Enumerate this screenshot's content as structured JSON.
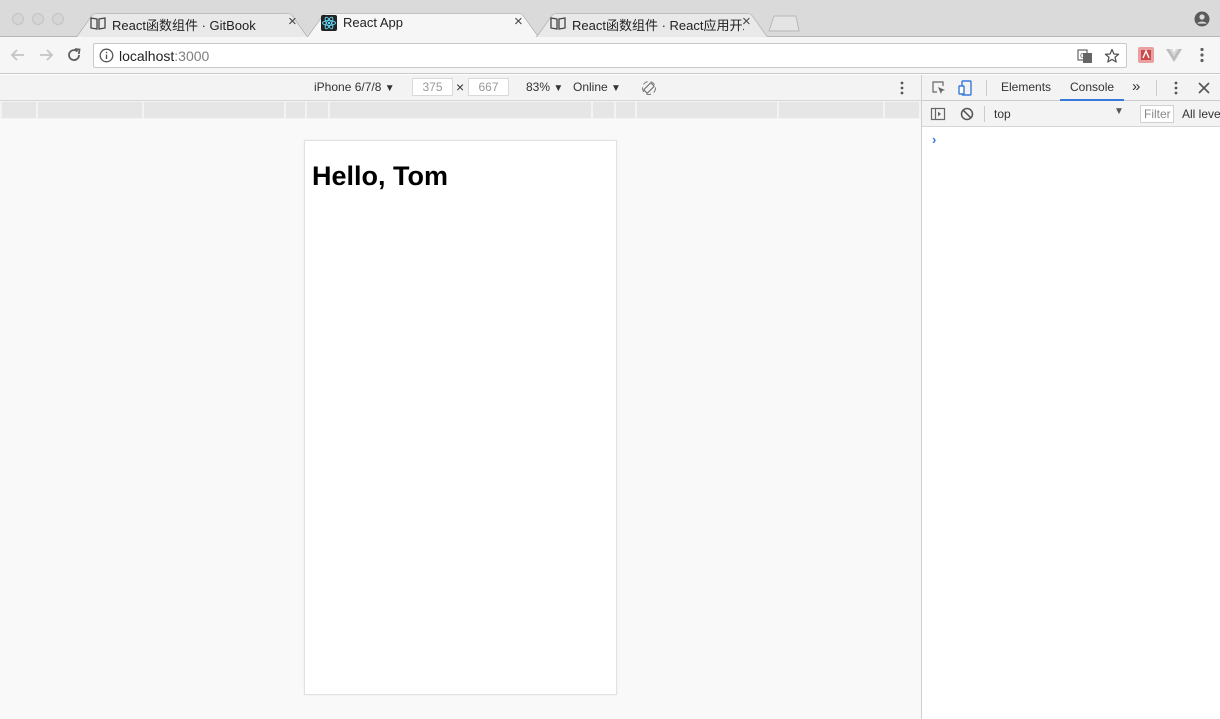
{
  "browser": {
    "tabs": [
      {
        "title": "React函数组件 · GitBook",
        "favicon": "book-icon",
        "active": false
      },
      {
        "title": "React App",
        "favicon": "react-logo-icon",
        "active": true
      },
      {
        "title": "React函数组件 · React应用开发",
        "favicon": "book-icon",
        "active": false
      }
    ],
    "close_glyph": "×",
    "address": {
      "host": "localhost",
      "port": ":3000"
    },
    "colors": {
      "tabstrip": "#dadada",
      "active_tab": "#f6f6f6",
      "accent": "#3879d9"
    }
  },
  "device_toolbar": {
    "device": "iPhone 6/7/8",
    "width": "375",
    "times": "×",
    "height": "667",
    "zoom": "83%",
    "network": "Online",
    "dropdown_glyph": "▼"
  },
  "page": {
    "heading": "Hello, Tom"
  },
  "devtools": {
    "tabs": [
      "Elements",
      "Console"
    ],
    "active_tab": "Console",
    "more_glyph": "»",
    "console": {
      "context": "top",
      "filter_placeholder": "Filter",
      "levels": "All levels",
      "prompt_glyph": "›"
    }
  }
}
